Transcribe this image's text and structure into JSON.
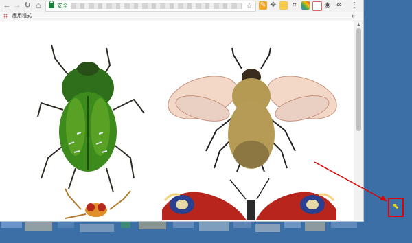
{
  "browser": {
    "omnibox": {
      "secure_label": "安全"
    },
    "bookmarks": {
      "apps_label": "應用程式",
      "more_label": "»"
    }
  },
  "colors": {
    "desktop": "#3b6fa6",
    "highlight": "#e00000",
    "secure": "#188038"
  },
  "icons": {
    "back": "back-icon",
    "forward": "forward-icon",
    "reload": "reload-icon",
    "home": "home-icon",
    "star": "bookmark-star-icon",
    "extensions": [
      "pen-icon",
      "move-icon",
      "eyedropper-icon",
      "crop-icon",
      "color-icon",
      "calendar-icon",
      "camera-icon",
      "eyes-icon",
      "menu-icon"
    ]
  },
  "content": {
    "images": [
      "green-beetle",
      "bumblebee",
      "fly",
      "peacock-butterfly"
    ]
  }
}
